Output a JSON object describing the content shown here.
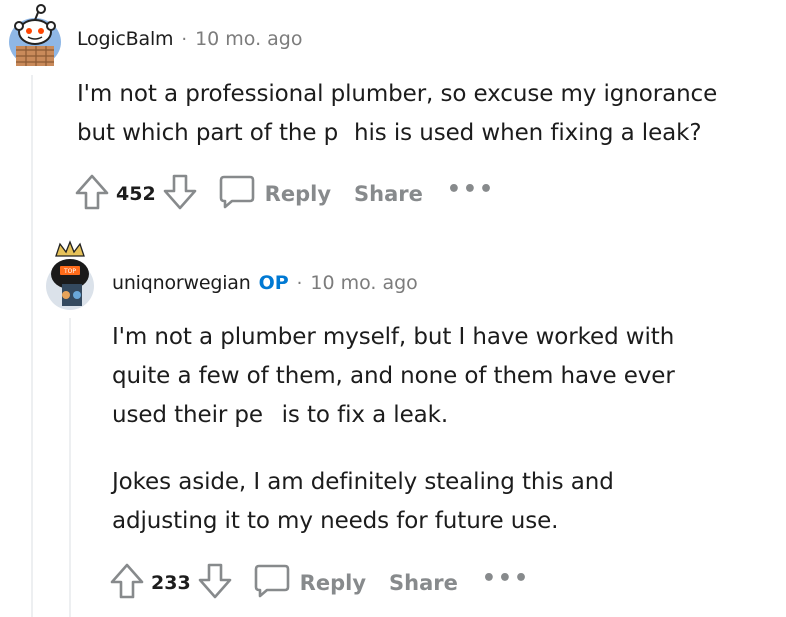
{
  "comments": [
    {
      "username": "LogicBalm",
      "separator": "·",
      "time": "10 mo. ago",
      "body": [
        [
          "I'm not a professional plumber, so excuse my ignorance",
          "but which part of the p  his is used when fixing a leak?"
        ]
      ],
      "score": "452",
      "reply_label": "Reply",
      "share_label": "Share",
      "more_label": "•••",
      "avatar_icon": "snoo-avatar-icon"
    },
    {
      "username": "uniqnorwegian",
      "op_label": "OP",
      "separator": "·",
      "time": "10 mo. ago",
      "body": [
        [
          "I'm not a plumber myself, but I have worked with",
          "quite a few of them, and none of them have ever",
          "used their pe  is to fix a leak."
        ],
        [
          "Jokes aside, I am definitely stealing this and",
          "adjusting it to my needs for future use."
        ]
      ],
      "score": "233",
      "reply_label": "Reply",
      "share_label": "Share",
      "more_label": "•••",
      "avatar_icon": "crowned-avatar-icon"
    }
  ],
  "colors": {
    "op": "#0079d3",
    "muted": "#878a8c",
    "thread_line": "#edeff1"
  }
}
